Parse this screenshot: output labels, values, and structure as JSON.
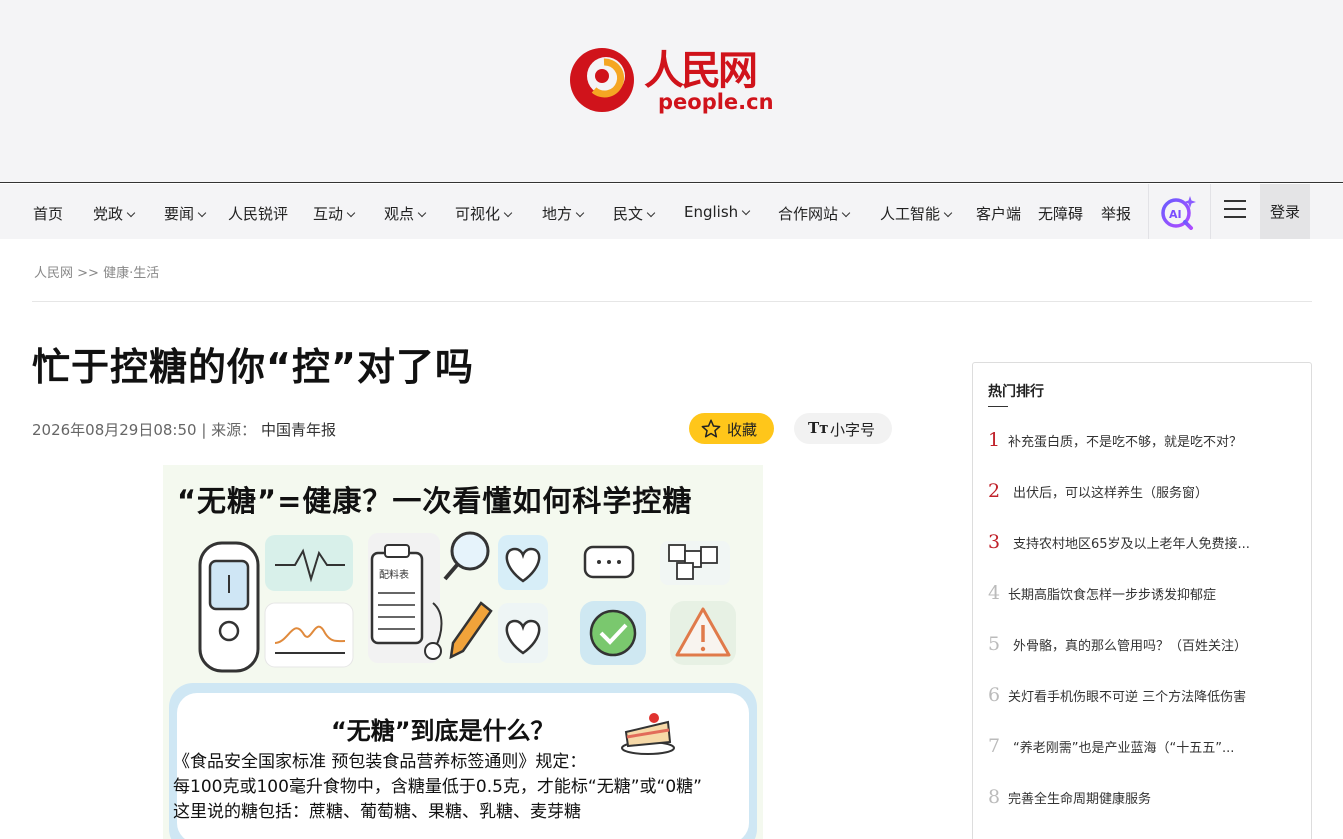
{
  "header": {
    "logo_cn": "人民网",
    "logo_en": "people.cn",
    "brand_color": "#d0131b"
  },
  "nav": {
    "items": [
      {
        "label": "首页",
        "dropdown": false
      },
      {
        "label": "党政",
        "dropdown": true
      },
      {
        "label": "要闻",
        "dropdown": true
      },
      {
        "label": "人民锐评",
        "dropdown": false
      },
      {
        "label": "互动",
        "dropdown": true
      },
      {
        "label": "观点",
        "dropdown": true
      },
      {
        "label": "可视化",
        "dropdown": true
      },
      {
        "label": "地方",
        "dropdown": true
      },
      {
        "label": "民文",
        "dropdown": true
      },
      {
        "label": "English",
        "dropdown": true
      },
      {
        "label": "合作网站",
        "dropdown": true
      },
      {
        "label": "人工智能",
        "dropdown": true
      },
      {
        "label": "客户端",
        "dropdown": false
      },
      {
        "label": "无障碍",
        "dropdown": false
      },
      {
        "label": "举报",
        "dropdown": false
      }
    ],
    "ai_icon": "ai-search-icon",
    "menu_icon": "hamburger-menu-icon",
    "login_label": "登录"
  },
  "breadcrumb": {
    "home": "人民网",
    "separator": ">>",
    "section": "健康·生活"
  },
  "article": {
    "title": "忙于控糖的你“控”对了吗",
    "datetime": "2026年08月29日08:50",
    "source_prefix": "| 来源：",
    "source": "中国青年报",
    "favorite_label": "收藏",
    "font_toggle_icon": "Tт",
    "font_toggle_label": "小字号"
  },
  "infographic": {
    "title": "“无糖”=健康？一次看懂如何科学控糖",
    "label_card": "配料表",
    "question": "“无糖”到底是什么？",
    "line1": "《食品安全国家标准 预包装食品营养标签通则》规定：",
    "line2": "每100克或100毫升食物中，含糖量低于0.5克，才能标“无糖”或“0糖”",
    "line3": "这里说的糖包括：蔗糖、葡萄糖、果糖、乳糖、麦芽糖"
  },
  "hot_list": {
    "title": "热门排行",
    "items": [
      {
        "rank": "1",
        "text": "补充蛋白质，不是吃不够，就是吃不对？"
      },
      {
        "rank": "2",
        "text": "出伏后，可以这样养生（服务窗）"
      },
      {
        "rank": "3",
        "text": "支持农村地区65岁及以上老年人免费接..."
      },
      {
        "rank": "4",
        "text": "长期高脂饮食怎样一步步诱发抑郁症"
      },
      {
        "rank": "5",
        "text": "外骨骼，真的那么管用吗？（百姓关注）"
      },
      {
        "rank": "6",
        "text": "关灯看手机伤眼不可逆 三个方法降低伤害"
      },
      {
        "rank": "7",
        "text": "“养老刚需”也是产业蓝海（“十五五”..."
      },
      {
        "rank": "8",
        "text": "完善全生命周期健康服务"
      }
    ]
  }
}
